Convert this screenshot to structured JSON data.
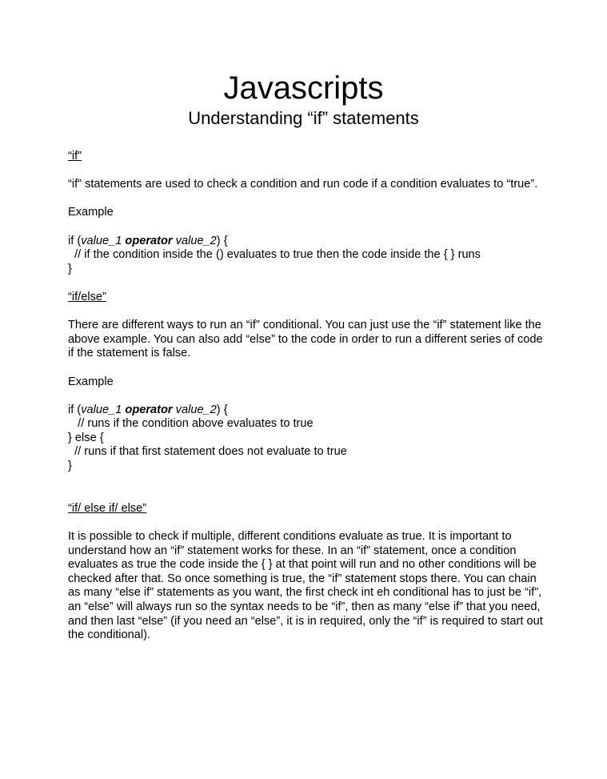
{
  "document": {
    "title": "Javascripts",
    "subtitle": "Understanding “if” statements"
  },
  "sections": {
    "if": {
      "heading": "“if”",
      "description": "“if” statements are used to check a condition and run code if a condition evaluates to “true”.",
      "example_label": "Example",
      "code": {
        "line1_prefix": "if (",
        "value_1": "value_1",
        "operator": "operator",
        "value_2": "value_2",
        "line1_suffix": ") {",
        "line2": "  // if the condition inside the () evaluates to true then the code inside the { } runs",
        "line3": "}"
      }
    },
    "if_else": {
      "heading": "“if/else”",
      "description": "There are different ways to run an “if” conditional.  You can just use the “if” statement like the above example.  You can also add “else” to the code in order to run a different series of code if the statement is false.",
      "example_label": "Example",
      "code": {
        "line1_prefix": "if (",
        "value_1": "value_1",
        "operator": "operator",
        "value_2": "value_2",
        "line1_suffix": ") {",
        "line2": "   // runs if the condition above evaluates to true",
        "line3": "} else {",
        "line4": "  // runs if that first statement does not evaluate to true",
        "line5": "}"
      }
    },
    "if_else_if_else": {
      "heading": "“if/ else if/ else”",
      "description": "It is possible to check if multiple, different conditions evaluate as true.  It is important to understand how an “if” statement works for these.  In an “if” statement, once a condition evaluates as true the code inside the { } at that point will run and no other conditions will be checked after that.  So once something is true, the “if” statement stops there.  You can chain as many “else if” statements as you want, the first check int eh conditional has to just be “if”, an “else” will always run so the syntax needs to be “if”, then as many “else if” that you need, and then last “else” (if you need an “else”, it is in required, only the “if” is required to start out the conditional)."
    }
  }
}
